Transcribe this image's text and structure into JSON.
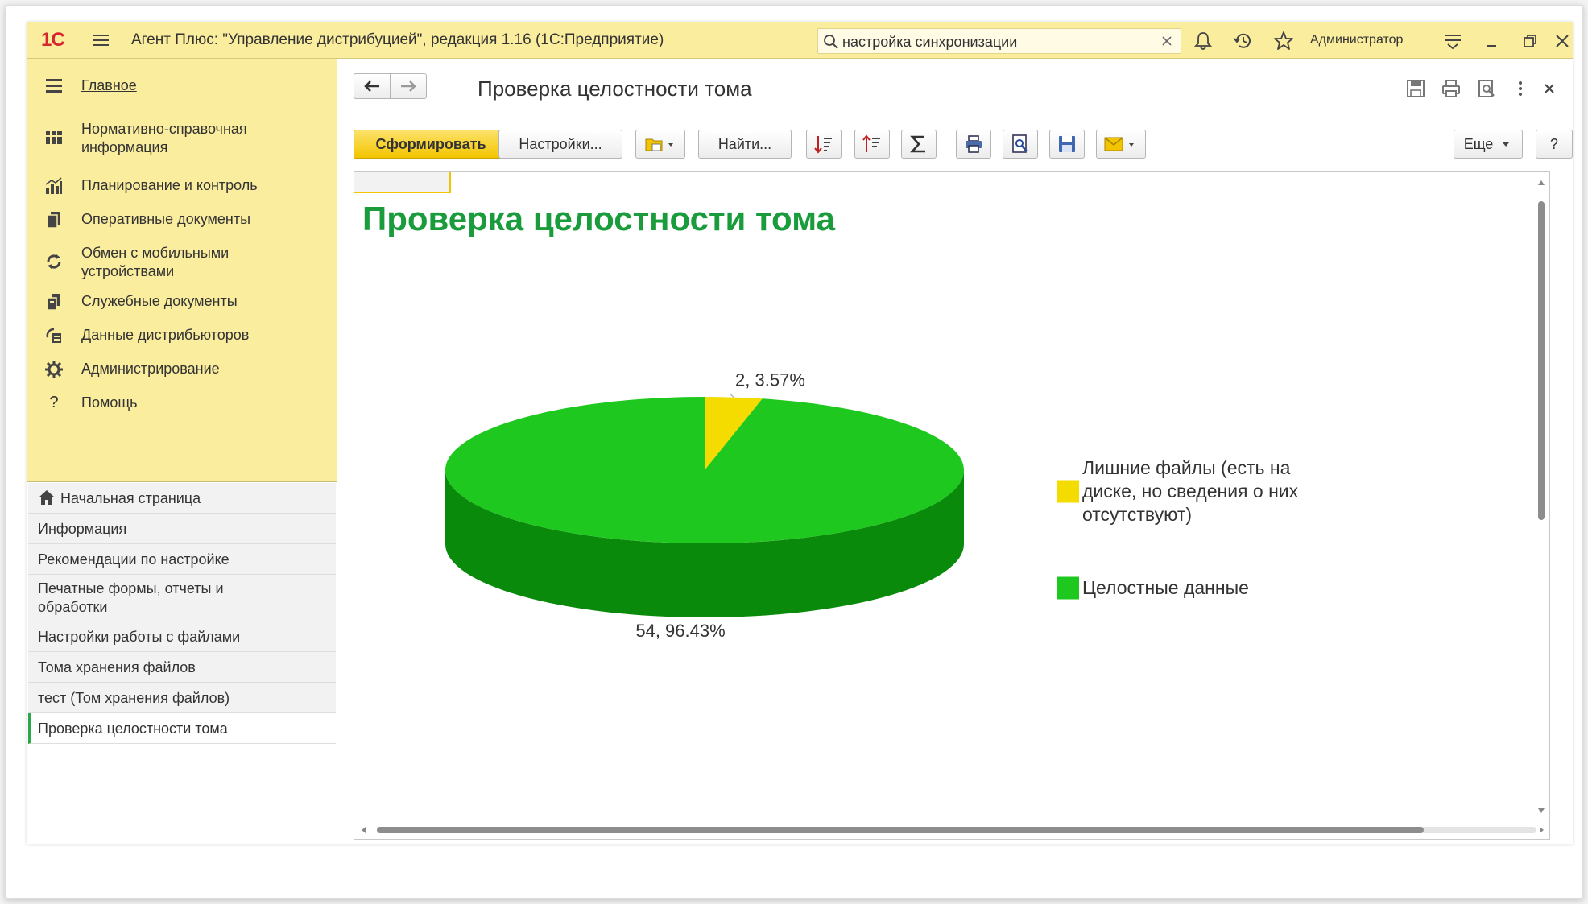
{
  "titlebar": {
    "logo": "1С",
    "app_title": "Агент Плюс: \"Управление дистрибуцией\", редакция 1.16  (1С:Предприятие)",
    "search_value": "настройка синхронизации",
    "username": "Администратор",
    "icons": [
      "menu-icon",
      "bell-icon",
      "history-icon",
      "star-icon",
      "settings-menu-icon",
      "minimize-icon",
      "restore-icon",
      "close-icon"
    ]
  },
  "sidebar": {
    "sections": [
      {
        "label": "Главное",
        "icon": "menu-lines-icon"
      },
      {
        "label": "Нормативно-справочная информация",
        "icon": "catalog-icon"
      },
      {
        "label": "Планирование и контроль",
        "icon": "bar-chart-icon"
      },
      {
        "label": "Оперативные документы",
        "icon": "documents-icon"
      },
      {
        "label": "Обмен с мобильными устройствами",
        "icon": "sync-icon"
      },
      {
        "label": "Служебные документы",
        "icon": "service-docs-icon"
      },
      {
        "label": "Данные дистрибьюторов",
        "icon": "distributors-icon"
      },
      {
        "label": "Администрирование",
        "icon": "gear-icon"
      },
      {
        "label": "Помощь",
        "icon": "question-icon"
      }
    ],
    "nav": [
      {
        "label": "Начальная страница",
        "icon": "home-icon"
      },
      {
        "label": "Информация"
      },
      {
        "label": "Рекомендации по настройке"
      },
      {
        "label": "Печатные формы, отчеты и обработки"
      },
      {
        "label": "Настройки работы с файлами"
      },
      {
        "label": "Тома хранения файлов"
      },
      {
        "label": "тест (Том хранения файлов)"
      },
      {
        "label": "Проверка целостности тома",
        "active": true
      }
    ]
  },
  "main": {
    "doc_title": "Проверка целостности тома",
    "toolbar": {
      "form_label": "Сформировать",
      "settings_label": "Настройки...",
      "find_label": "Найти...",
      "more_label": "Еще",
      "help_label": "?"
    }
  },
  "report": {
    "title": "Проверка целостности тома"
  },
  "chart_data": {
    "type": "pie",
    "style": "3d",
    "title": "Проверка целостности тома",
    "categories": [
      "Лишние файлы (есть на диске, но сведения о них отсутствуют)",
      "Целостные данные"
    ],
    "values": [
      2,
      54
    ],
    "percents": [
      3.57,
      96.43
    ],
    "data_labels": [
      "2, 3.57%",
      "54, 96.43%"
    ],
    "colors": [
      "#f5dc00",
      "#1ec81e"
    ],
    "side_colors": [
      "#c7b300",
      "#0a8a0a"
    ],
    "legend": {
      "position": "right",
      "items": [
        {
          "lines": [
            "Лишние файлы (есть на",
            "диске, но сведения о них",
            "отсутствуют)"
          ],
          "color": "#f5dc00"
        },
        {
          "lines": [
            "Целостные данные"
          ],
          "color": "#1ec81e"
        }
      ]
    }
  }
}
